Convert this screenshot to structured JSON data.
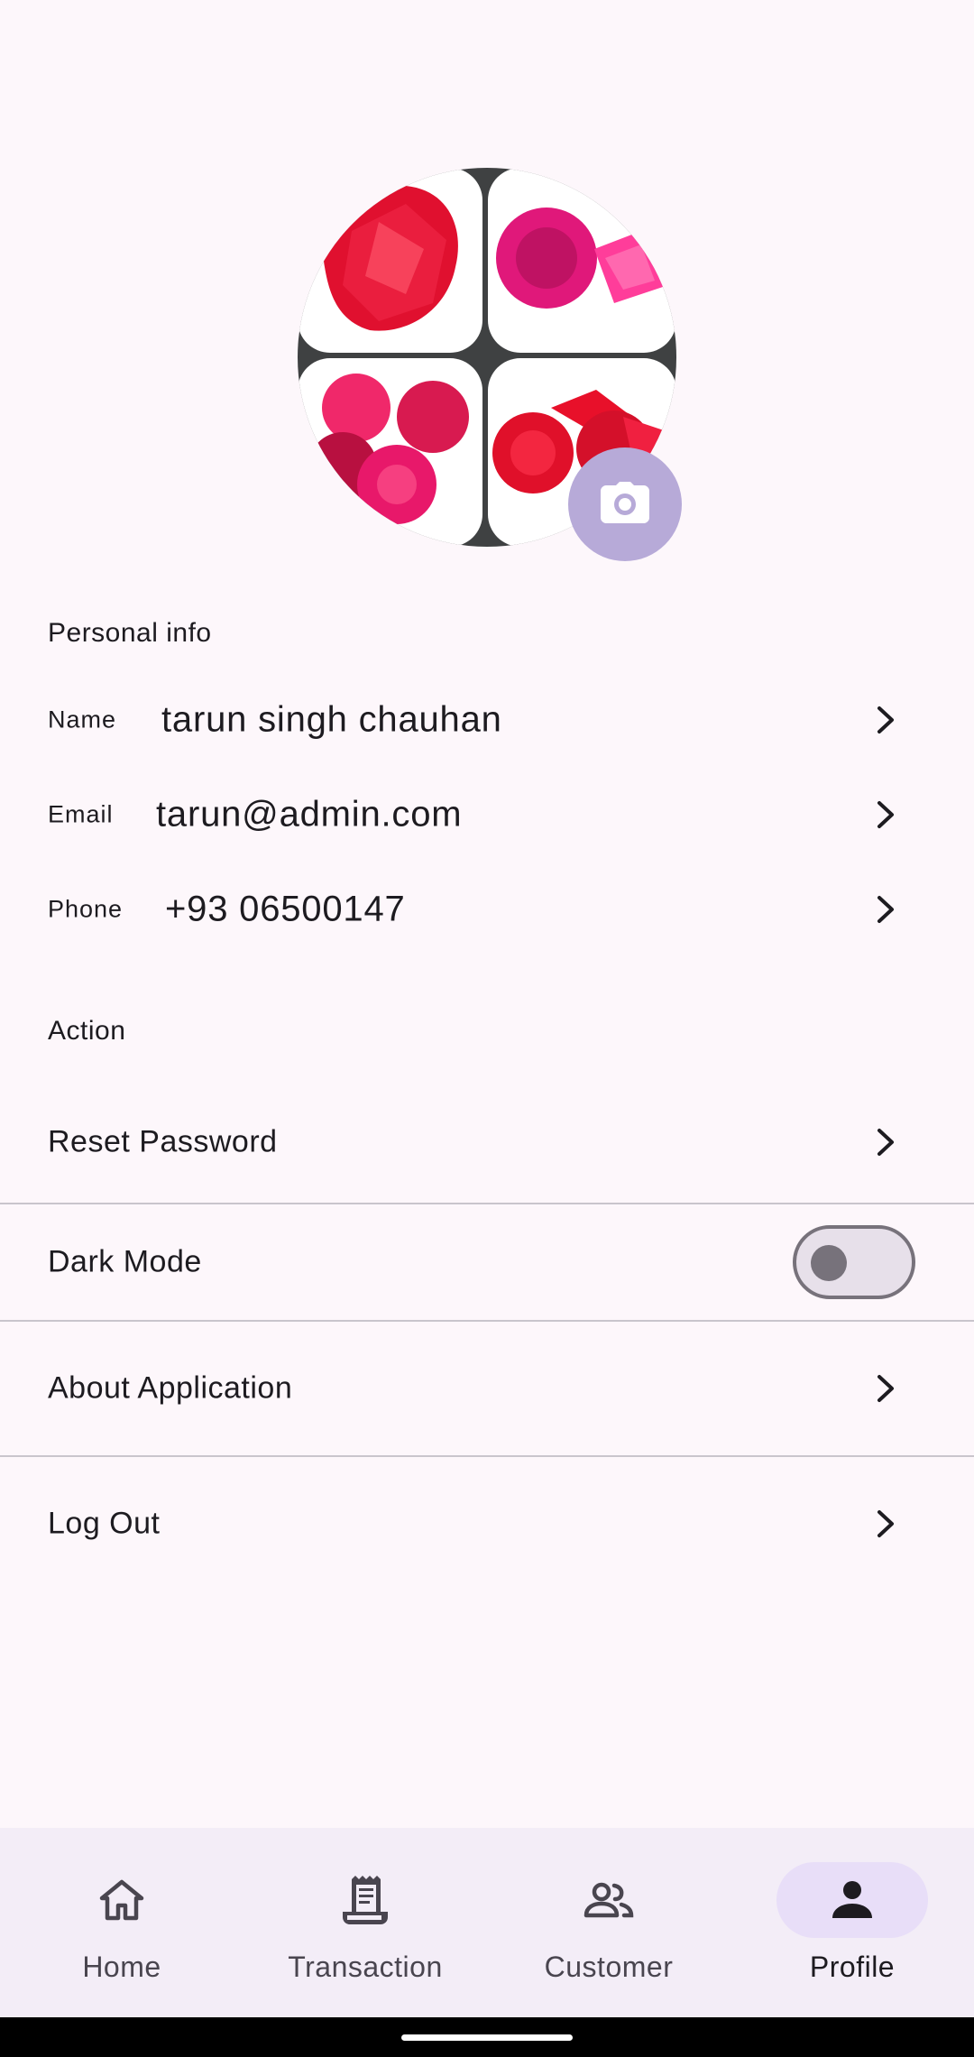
{
  "profile": {
    "camera_icon": "camera-icon",
    "avatar_icon": "gemstone-photo-collage"
  },
  "personal_info": {
    "title": "Personal info",
    "rows": [
      {
        "label": "Name",
        "value": "tarun singh chauhan"
      },
      {
        "label": "Email",
        "value": "tarun@admin.com"
      },
      {
        "label": "Phone",
        "value": "+93 06500147"
      }
    ]
  },
  "action": {
    "title": "Action",
    "items": [
      {
        "label": "Reset Password",
        "control": "chevron"
      },
      {
        "label": "Dark Mode",
        "control": "toggle",
        "enabled": false
      },
      {
        "label": "About Application",
        "control": "chevron"
      },
      {
        "label": "Log Out",
        "control": "chevron"
      }
    ]
  },
  "bottom_nav": {
    "items": [
      {
        "label": "Home",
        "icon": "home-icon",
        "active": false
      },
      {
        "label": "Transaction",
        "icon": "receipt-icon",
        "active": false
      },
      {
        "label": "Customer",
        "icon": "people-icon",
        "active": false
      },
      {
        "label": "Profile",
        "icon": "person-icon",
        "active": true
      }
    ]
  },
  "colors": {
    "background": "#fdf7fb",
    "accent_container": "#e8def8",
    "camera_button": "#b7aad8",
    "nav_background": "#f3edf7"
  }
}
